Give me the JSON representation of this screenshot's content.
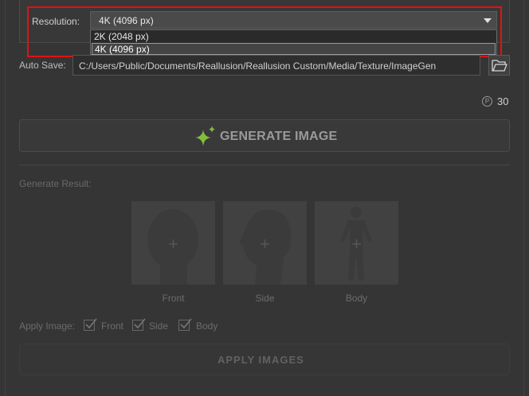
{
  "resolution": {
    "label": "Resolution:",
    "selected": "4K (4096 px)",
    "options": [
      "2K (2048 px)",
      "4K (4096 px)"
    ]
  },
  "auto_save": {
    "label": "Auto Save:",
    "path": "C:/Users/Public/Documents/Reallusion/Reallusion Custom/Media/Texture/ImageGen"
  },
  "credits": {
    "icon": "P",
    "count": "30"
  },
  "generate": {
    "label": "GENERATE IMAGE",
    "icon_color": "#7fbf3a"
  },
  "result": {
    "label": "Generate Result:",
    "thumbnails": [
      {
        "label": "Front"
      },
      {
        "label": "Side"
      },
      {
        "label": "Body"
      }
    ]
  },
  "apply": {
    "label": "Apply Image:",
    "checks": [
      {
        "label": "Front",
        "checked": true
      },
      {
        "label": "Side",
        "checked": true
      },
      {
        "label": "Body",
        "checked": true
      }
    ],
    "button_label": "APPLY IMAGES"
  },
  "colors": {
    "highlight": "#e01212",
    "background": "#353535"
  }
}
